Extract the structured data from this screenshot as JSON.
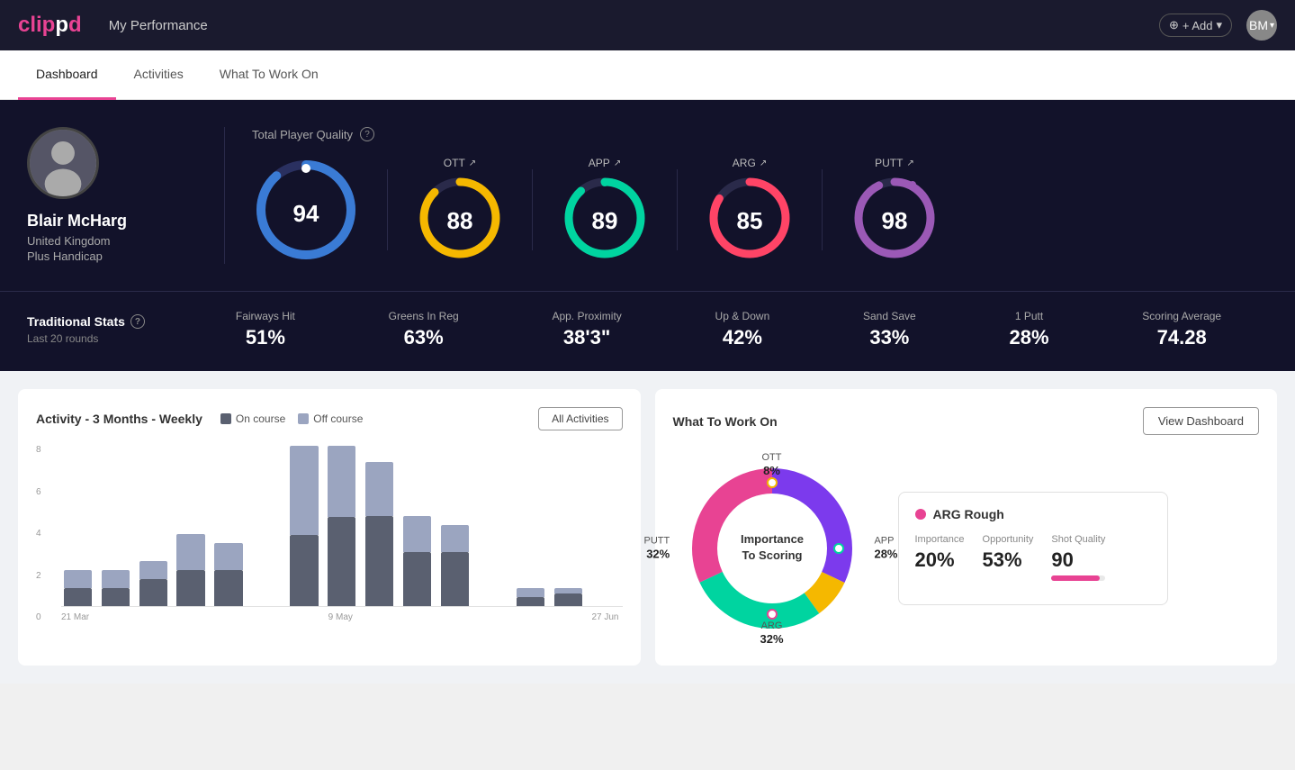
{
  "app": {
    "logo": "clippd",
    "logo_highlight": "d",
    "title": "My Performance"
  },
  "header": {
    "add_label": "+ Add",
    "avatar_initials": "BM"
  },
  "nav": {
    "tabs": [
      {
        "id": "dashboard",
        "label": "Dashboard",
        "active": true
      },
      {
        "id": "activities",
        "label": "Activities",
        "active": false
      },
      {
        "id": "what-to-work-on",
        "label": "What To Work On",
        "active": false
      }
    ]
  },
  "player": {
    "name": "Blair McHarg",
    "country": "United Kingdom",
    "handicap": "Plus Handicap",
    "avatar_emoji": "🧍"
  },
  "quality": {
    "section_title": "Total Player Quality",
    "gauges": [
      {
        "id": "total",
        "label": "",
        "value": "94",
        "color": "#3a7bd5",
        "size": 120,
        "stroke": 10
      },
      {
        "id": "ott",
        "label": "OTT ↗",
        "value": "88",
        "color": "#f5b800",
        "size": 100,
        "stroke": 9
      },
      {
        "id": "app",
        "label": "APP ↗",
        "value": "89",
        "color": "#00d4a0",
        "size": 100,
        "stroke": 9
      },
      {
        "id": "arg",
        "label": "ARG ↗",
        "value": "85",
        "color": "#ff4466",
        "size": 100,
        "stroke": 9
      },
      {
        "id": "putt",
        "label": "PUTT ↗",
        "value": "98",
        "color": "#9b59b6",
        "size": 100,
        "stroke": 9
      }
    ]
  },
  "trad_stats": {
    "title": "Traditional Stats",
    "subtitle": "Last 20 rounds",
    "items": [
      {
        "label": "Fairways Hit",
        "value": "51%"
      },
      {
        "label": "Greens In Reg",
        "value": "63%"
      },
      {
        "label": "App. Proximity",
        "value": "38'3\""
      },
      {
        "label": "Up & Down",
        "value": "42%"
      },
      {
        "label": "Sand Save",
        "value": "33%"
      },
      {
        "label": "1 Putt",
        "value": "28%"
      },
      {
        "label": "Scoring Average",
        "value": "74.28"
      }
    ]
  },
  "activity_chart": {
    "title": "Activity - 3 Months - Weekly",
    "legend_oncourse": "On course",
    "legend_offcourse": "Off course",
    "all_activities_btn": "All Activities",
    "yaxis_labels": [
      "8",
      "6",
      "4",
      "2",
      "0"
    ],
    "xaxis_labels": [
      "21 Mar",
      "9 May",
      "27 Jun"
    ],
    "bars": [
      {
        "on": 1,
        "off": 1
      },
      {
        "on": 1,
        "off": 1
      },
      {
        "on": 1.5,
        "off": 1
      },
      {
        "on": 2,
        "off": 2
      },
      {
        "on": 2,
        "off": 1.5
      },
      {
        "on": 0,
        "off": 0
      },
      {
        "on": 4,
        "off": 5
      },
      {
        "on": 5,
        "off": 4
      },
      {
        "on": 5,
        "off": 3
      },
      {
        "on": 3,
        "off": 2
      },
      {
        "on": 3,
        "off": 1.5
      },
      {
        "on": 0,
        "off": 0
      },
      {
        "on": 0.5,
        "off": 0.5
      },
      {
        "on": 0.7,
        "off": 0.3
      },
      {
        "on": 0,
        "off": 0
      }
    ]
  },
  "what_to_work_on": {
    "title": "What To Work On",
    "view_dashboard_btn": "View Dashboard",
    "donut_center": "Importance\nTo Scoring",
    "segments": [
      {
        "label": "OTT",
        "value": "8%",
        "color": "#f5b800",
        "pct": 8
      },
      {
        "label": "APP",
        "value": "28%",
        "color": "#00d4a0",
        "pct": 28
      },
      {
        "label": "ARG",
        "value": "32%",
        "color": "#e84393",
        "pct": 32
      },
      {
        "label": "PUTT",
        "value": "32%",
        "color": "#7c3aed",
        "pct": 32
      }
    ],
    "detail": {
      "title": "ARG Rough",
      "dot_color": "#e84393",
      "metrics": [
        {
          "label": "Importance",
          "value": "20%"
        },
        {
          "label": "Opportunity",
          "value": "53%"
        },
        {
          "label": "Shot Quality",
          "value": "90"
        }
      ]
    }
  },
  "colors": {
    "accent": "#e84393",
    "dark_bg": "#12122a",
    "nav_bg": "#1a1a2e"
  }
}
